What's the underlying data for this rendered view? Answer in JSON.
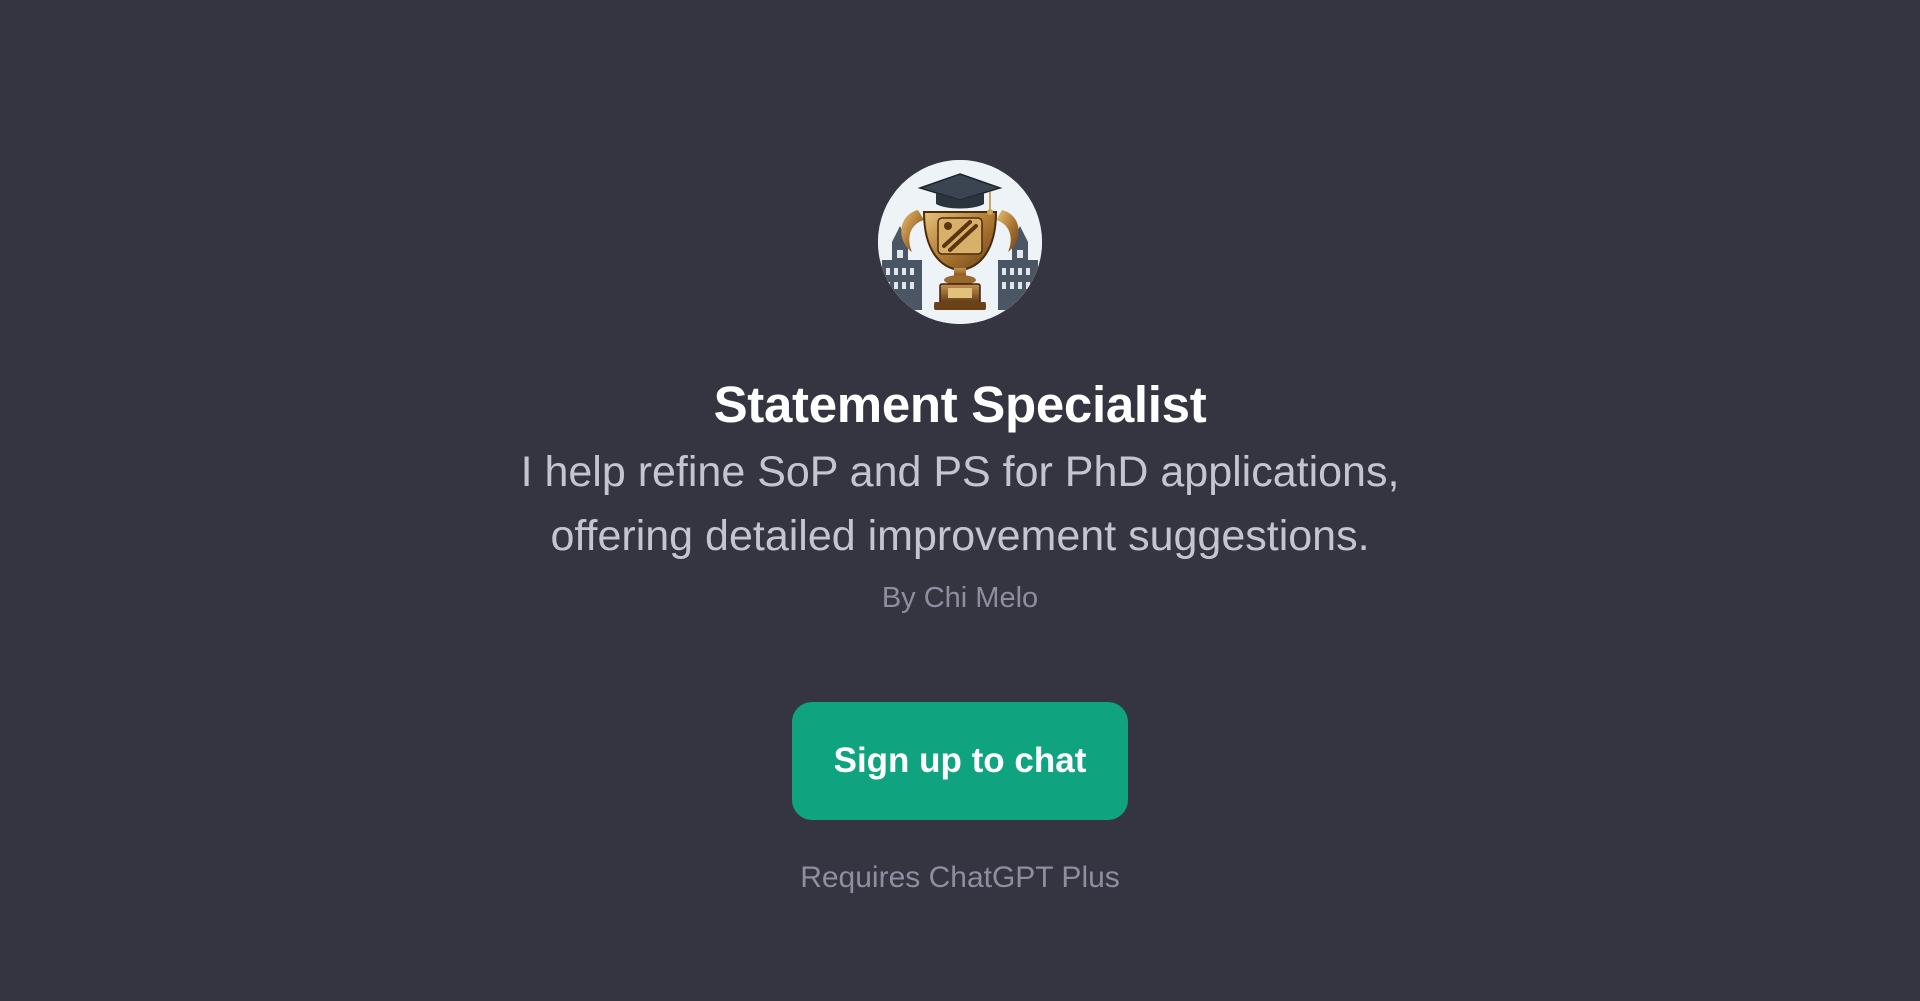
{
  "gpt": {
    "name": "Statement Specialist",
    "description": "I help refine SoP and PS for PhD applications, offering detailed improvement suggestions.",
    "author": "By Chi Melo",
    "avatar_icon": "trophy-graduation-cap-icon"
  },
  "actions": {
    "signup_label": "Sign up to chat"
  },
  "footer": {
    "requirement": "Requires ChatGPT Plus"
  },
  "colors": {
    "background": "#343541",
    "accent": "#10a37f",
    "title": "#ffffff",
    "description": "#c5c5d2",
    "muted": "#8e8ea0"
  }
}
